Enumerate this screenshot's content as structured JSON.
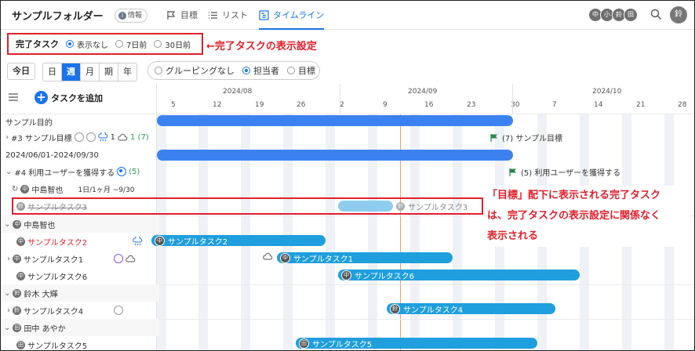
{
  "header": {
    "folder_title": "サンプルフォルダー",
    "info_label": "情報",
    "tabs": [
      {
        "label": "目標",
        "icon": "flag-icon"
      },
      {
        "label": "リスト",
        "icon": "list-icon"
      },
      {
        "label": "タイムライン",
        "icon": "timeline-icon",
        "active": true
      }
    ],
    "member_avatars": [
      "中",
      "小",
      "鈴",
      "田"
    ],
    "user_avatar": "鈴"
  },
  "completed_setting": {
    "label": "完了タスク",
    "options": [
      "表示なし",
      "7日前",
      "30日前"
    ],
    "selected": "表示なし",
    "annotation": "←完了タスクの表示設定"
  },
  "view": {
    "today_label": "今日",
    "scales": [
      "日",
      "週",
      "月",
      "期",
      "年"
    ],
    "active_scale": "週",
    "grouping_options": [
      "グルーピングなし",
      "担当者",
      "目標"
    ],
    "grouping_selected": "担当者"
  },
  "left": {
    "add_task_label": "タスクを追加",
    "rows": {
      "purpose_name": "サンプル目的",
      "goal3_name": "#3 サンプル目標",
      "goal3_count1": "1",
      "goal3_count2": "1 (7)",
      "period": "2024/06/01-2024/09/30",
      "goal4_name": "#4 利用ユーザーを獲得する",
      "goal4_count": "(5)",
      "owner_name": "中島智也",
      "owner_avatar": "中",
      "owner_schedule": "1日/1ヶ月 ~9/30",
      "completed_task": "サンプルタスク3",
      "completed_avatar": "鈴",
      "group1_name": "中島智也",
      "group1_avatar": "中",
      "task2": "サンプルタスク2",
      "task1": "サンプルタスク1",
      "task6": "サンプルタスク6",
      "group2_name": "鈴木 大輝",
      "group2_avatar": "鈴",
      "task4": "サンプルタスク4",
      "group3_name": "田中 あやか",
      "group3_avatar": "田",
      "task5": "サンプルタスク5"
    }
  },
  "timeline": {
    "months": [
      "2024/08",
      "2024/09",
      "2024/10"
    ],
    "days": [
      "5",
      "12",
      "19",
      "26",
      "2",
      "9",
      "16",
      "23",
      "30",
      "7",
      "14",
      "21",
      "28"
    ],
    "bars": {
      "goal3_flag": "(7) サンプル目標",
      "goal4_flag": "(5) 利用ユーザーを獲得する",
      "completed_bar": "サンプルタスク3",
      "task2_bar": "サンプルタスク2",
      "task1_bar": "サンプルタスク1",
      "task6_bar": "サンプルタスク6",
      "task4_bar": "サンプルタスク4",
      "task5_bar": "サンプルタスク5"
    },
    "annotation_lines": [
      "「目標」配下に表示される完了タスク",
      "は、完了タスクの表示設定に関係なく",
      "表示される"
    ]
  },
  "colors": {
    "accent": "#1a73e8",
    "annotation_red": "#e0202c",
    "bar_blue": "#3b82f0",
    "bar_cyan": "#1f9fdd",
    "today_line": "#f0a060"
  }
}
